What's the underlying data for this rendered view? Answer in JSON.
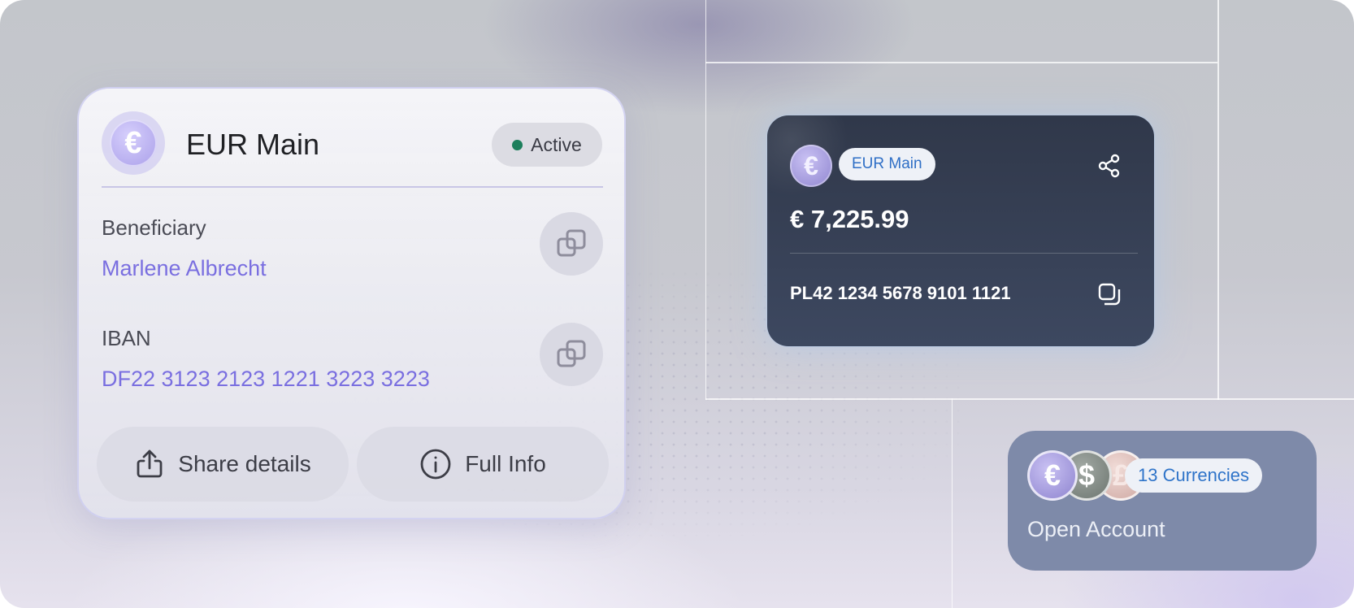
{
  "detail_card": {
    "title": "EUR Main",
    "currency_symbol": "€",
    "status": "Active",
    "status_color": "#1d7f5c",
    "beneficiary_label": "Beneficiary",
    "beneficiary_value": "Marlene Albrecht",
    "iban_label": "IBAN",
    "iban_value": "DF22 3123 2123 1221 3223 3223",
    "share_button": "Share details",
    "info_button": "Full Info",
    "accent_color": "#7a6fe0"
  },
  "account_card": {
    "currency_symbol": "€",
    "account_name": "EUR Main",
    "balance": "€ 7,225.99",
    "iban": "PL42 1234 5678 9101 1121"
  },
  "open_account_card": {
    "coins": [
      "€",
      "$",
      "£"
    ],
    "currencies_label": "13 Currencies",
    "title": "Open Account"
  },
  "icons": {
    "share": "share-icon",
    "copy": "copy-icon",
    "info": "info-icon",
    "upload": "upload-icon"
  }
}
